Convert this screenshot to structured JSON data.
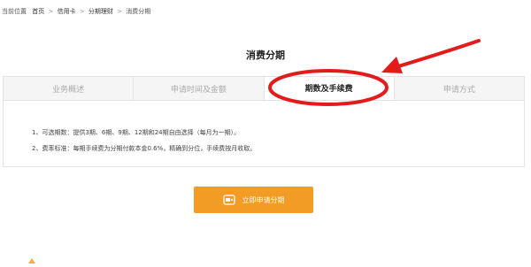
{
  "breadcrumb": {
    "prefix": "当前位置",
    "items": [
      "首页",
      "信用卡",
      "分期理财",
      "消费分期"
    ],
    "separator": ">"
  },
  "page": {
    "title": "消费分期"
  },
  "tabs": [
    {
      "label": "业务概述",
      "active": false
    },
    {
      "label": "申请时间及金额",
      "active": false
    },
    {
      "label": "期数及手续费",
      "active": true
    },
    {
      "label": "申请方式",
      "active": false
    }
  ],
  "content": {
    "lines": [
      "1、可选期数：提供3期、6期、9期、12期和24期自由选择（每月为一期）。",
      "2、费率标准：每期手续费为分期付款本金0.6%，精确到分位，手续费按月收取。"
    ]
  },
  "button": {
    "label": "立即申请分期",
    "icon": "card-icon"
  },
  "colors": {
    "accent": "#f29b25",
    "annotation": "#e31b1b"
  }
}
